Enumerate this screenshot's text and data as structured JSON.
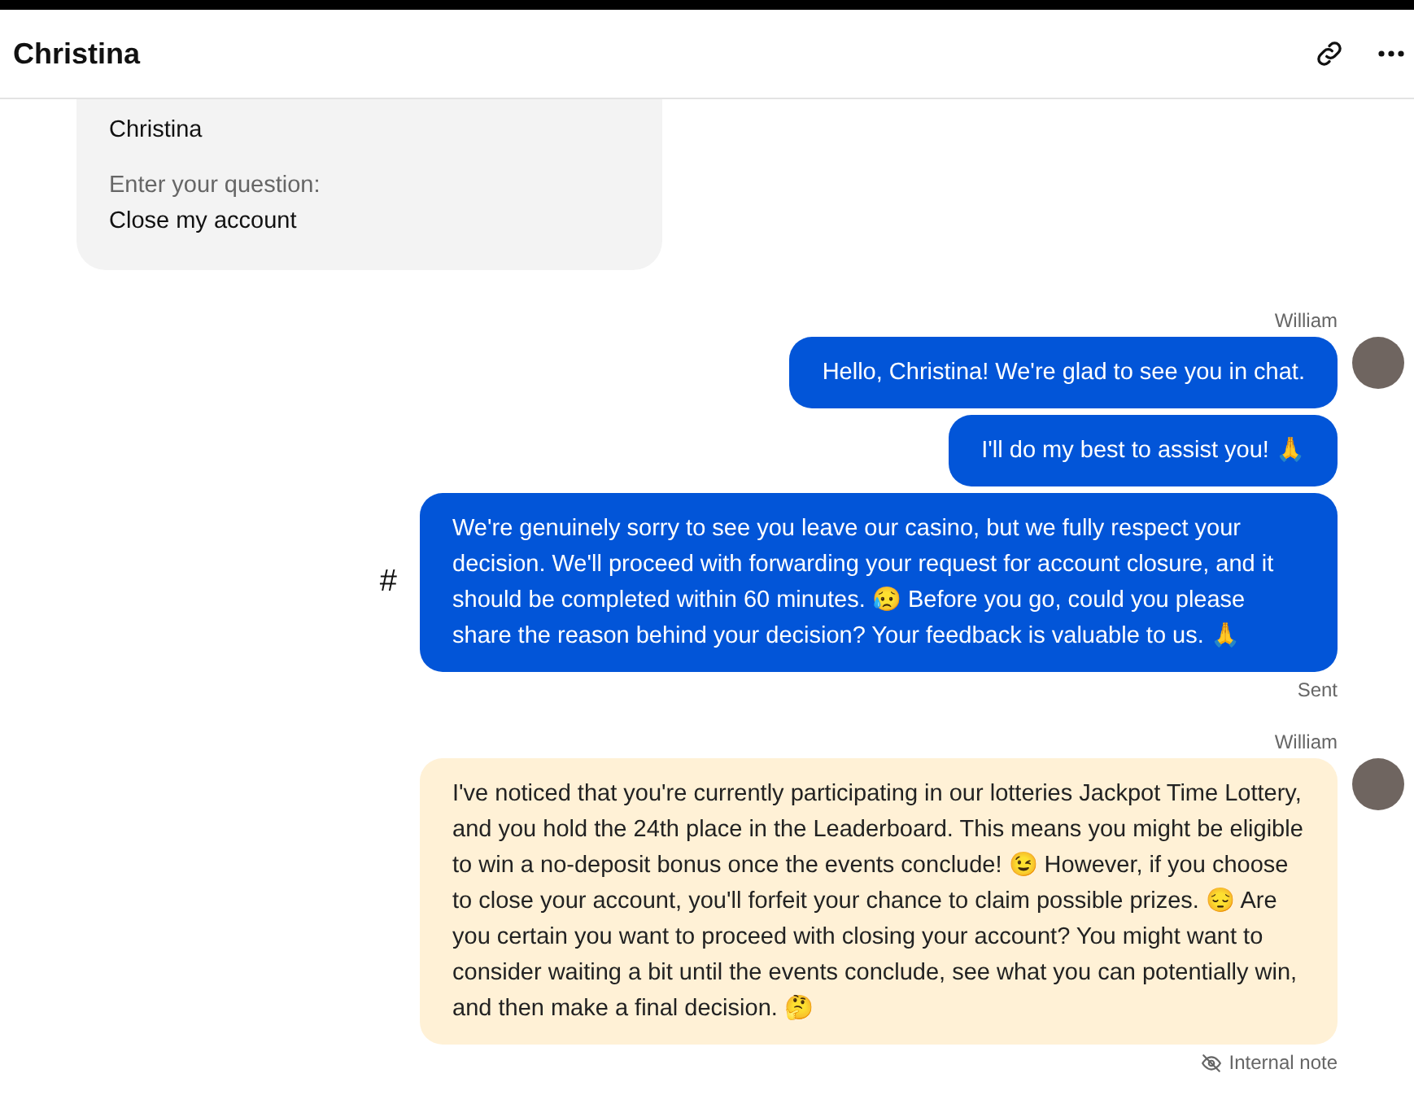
{
  "header": {
    "title": "Christina"
  },
  "form_card": {
    "fields": [
      {
        "value": "Christina"
      },
      {
        "label": "Enter your question:",
        "value": "Close my account"
      }
    ]
  },
  "groups": [
    {
      "author": "William",
      "status": {
        "kind": "sent",
        "text": "Sent"
      },
      "messages": [
        {
          "kind": "message",
          "text": "Hello, Christina! We're glad to see you in chat."
        },
        {
          "kind": "message",
          "text": "I'll do my best to assist you! 🙏"
        },
        {
          "kind": "message",
          "side_mark": "#",
          "text": "We're genuinely sorry to see you leave our casino, but we fully respect your decision. We'll proceed with forwarding your request for account closure, and it should be completed within 60 minutes. 😥 Before you go, could you please share the reason behind your decision? Your feedback is valuable to us. 🙏"
        }
      ]
    },
    {
      "author": "William",
      "status": {
        "kind": "internal",
        "text": "Internal note"
      },
      "messages": [
        {
          "kind": "note",
          "text": "I've noticed that you're currently participating in our lotteries Jackpot Time Lottery, and you hold the 24th place in the Leaderboard. This means you might be eligible to win a no-deposit bonus once the events conclude! 😉 However, if you choose to close your account, you'll forfeit your chance to claim possible prizes. 😔 Are you certain you want to proceed with closing your account? You might want to consider waiting a bit until the events conclude, see what you can potentially win, and then make a final decision. 🤔"
        }
      ]
    }
  ]
}
